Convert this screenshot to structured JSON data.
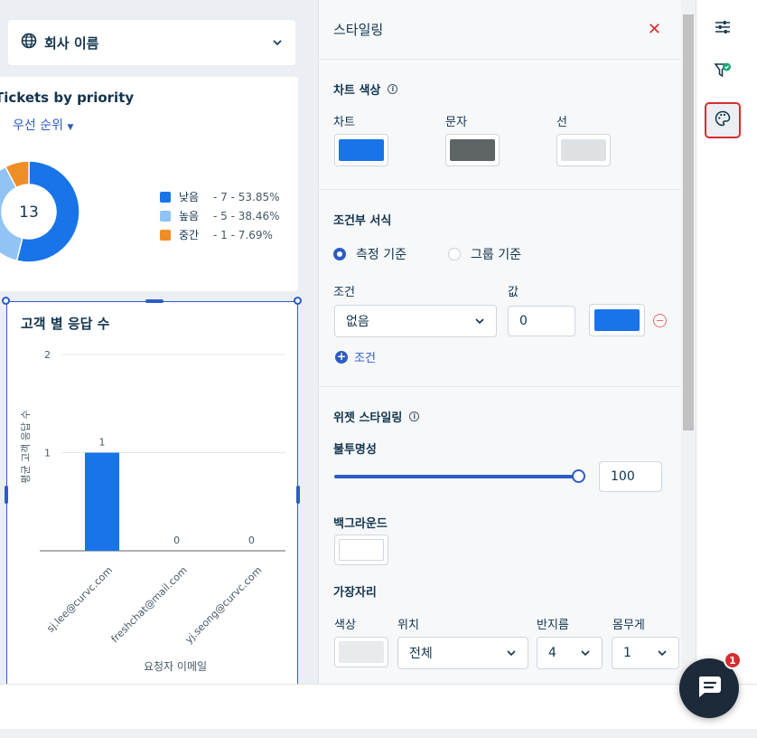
{
  "dashboard": {
    "filter": {
      "label": "회사 이름",
      "icon": "globe-icon"
    },
    "pie_widget": {
      "title": "Tickets by priority",
      "group_filter": "우선 순위",
      "center_value": "13",
      "legend": [
        {
          "name": "낮음",
          "detail": "- 7 - 53.85%",
          "color": "#1874e8"
        },
        {
          "name": "높음",
          "detail": "- 5 - 38.46%",
          "color": "#91c3f5"
        },
        {
          "name": "중간",
          "detail": "- 1 - 7.69%",
          "color": "#ef8d26"
        }
      ]
    },
    "bar_widget": {
      "title": "고객 별 응답 수",
      "ylabel": "평균 고객 응답 수",
      "xlabel": "요청자 이메일"
    }
  },
  "chart_data": [
    {
      "type": "pie",
      "title": "Tickets by priority",
      "categories": [
        "낮음",
        "높음",
        "중간"
      ],
      "values": [
        7,
        5,
        1
      ],
      "percentages": [
        53.85,
        38.46,
        7.69
      ],
      "total": 13,
      "colors": [
        "#1874e8",
        "#91c3f5",
        "#ef8d26"
      ],
      "legend": "right"
    },
    {
      "type": "bar",
      "title": "고객 별 응답 수",
      "categories": [
        "sj.lee@curvc.com",
        "freshchat@mail.com",
        "yj.seong@curvc.com"
      ],
      "values": [
        1,
        0,
        0
      ],
      "xlabel": "요청자 이메일",
      "ylabel": "평균 고객 응답 수",
      "yticks": [
        "1",
        "2"
      ],
      "ylim": [
        0,
        2
      ],
      "grid": true,
      "color": "#1874e8"
    }
  ],
  "panel": {
    "title": "스타일링",
    "chart_colors": {
      "title": "차트 색상",
      "items": [
        {
          "label": "차트",
          "color": "#1874e8"
        },
        {
          "label": "문자",
          "color": "#5f6467"
        },
        {
          "label": "선",
          "color": "#dfe2e5"
        }
      ]
    },
    "conditional": {
      "title": "조건부 서식",
      "options": [
        "측정 기준",
        "그룹 기준"
      ],
      "selected": "측정 기준",
      "condition_label": "조건",
      "value_label": "값",
      "condition_value": "없음",
      "value": "0",
      "color": "#1874e8",
      "add_label": "조건"
    },
    "widget_style": {
      "title": "위젯 스타일링",
      "opacity_label": "불투명성",
      "opacity_value": "100",
      "opacity_fraction": 1.0,
      "background_label": "백그라운드",
      "background_color": "#ffffff",
      "border_title": "가장자리",
      "border_color_label": "색상",
      "border_color": "#e8eaed",
      "position_label": "위치",
      "position_value": "전체",
      "radius_label": "반지름",
      "radius_value": "4",
      "weight_label": "몸무게",
      "weight_value": "1"
    }
  },
  "rail": {
    "buttons": [
      "sliders-icon",
      "filter-check-icon",
      "palette-icon"
    ],
    "active": "palette-icon"
  },
  "chat": {
    "badge": "1"
  }
}
